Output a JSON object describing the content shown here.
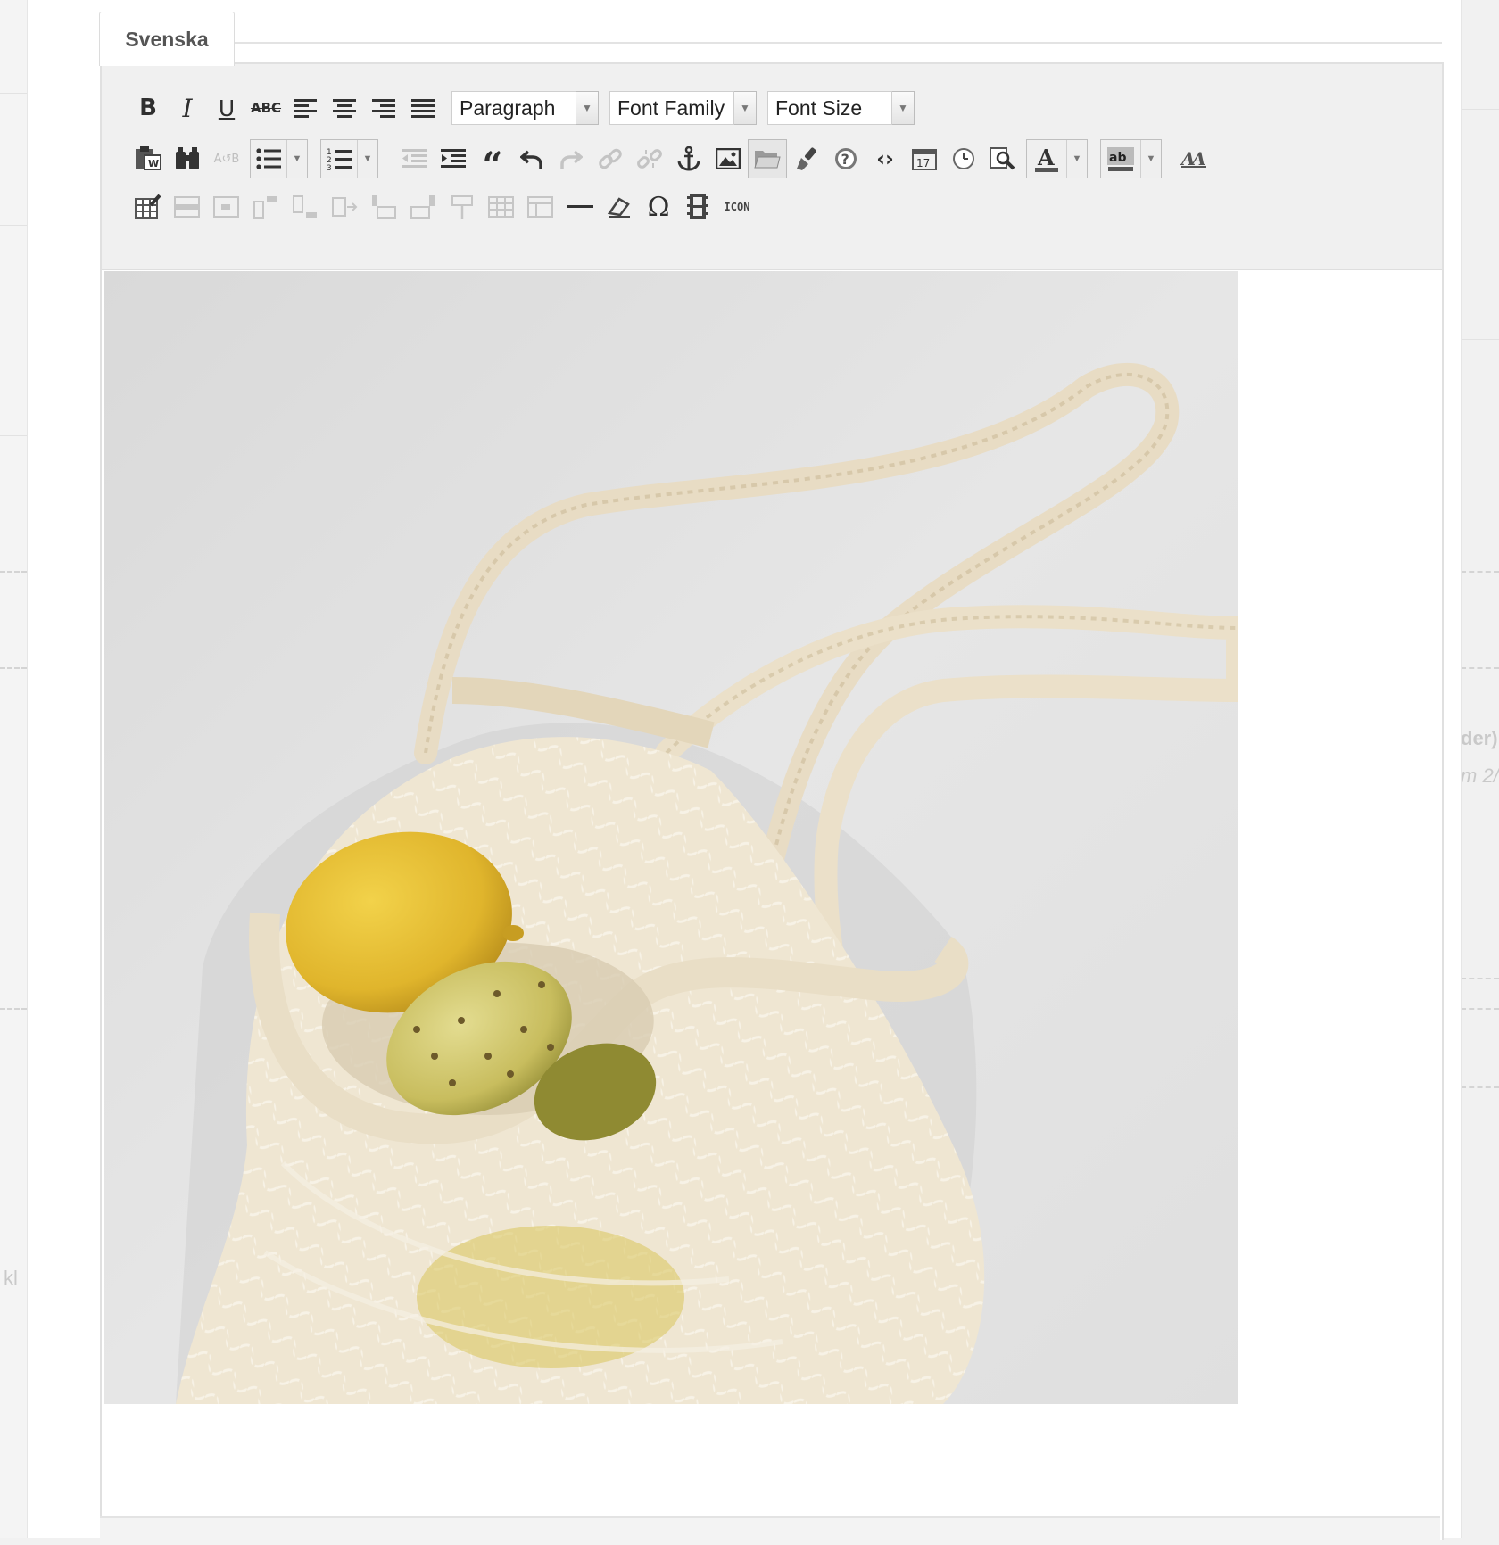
{
  "language_tab": {
    "label": "Svenska"
  },
  "toolbar": {
    "format_select": "Paragraph",
    "font_family_select": "Font Family",
    "font_size_select": "Font Size",
    "media_button_label": "ICON"
  },
  "background": {
    "right_text_1": "der)",
    "right_text_2": "m 2/",
    "left_text": "kl"
  },
  "editor_content": {
    "image": "string-bag-with-lemon-photo"
  }
}
